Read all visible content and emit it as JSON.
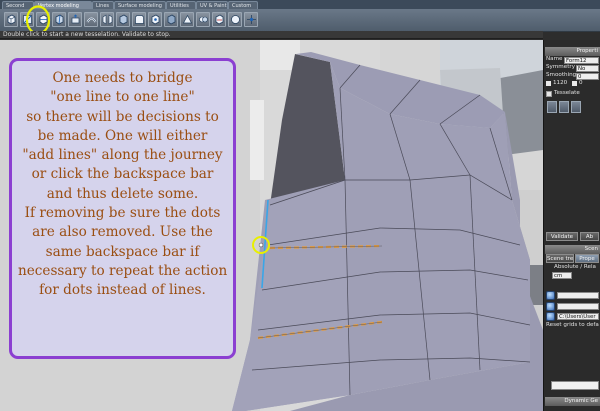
{
  "tabs": [
    {
      "label": "Second",
      "active": false
    },
    {
      "label": "Vertex modeling",
      "active": true
    },
    {
      "label": "Lines",
      "active": false
    },
    {
      "label": "Surface modeling",
      "active": false
    },
    {
      "label": "Utilities",
      "active": false
    },
    {
      "label": "UV & Paint",
      "active": false
    },
    {
      "label": "Custom",
      "active": false
    }
  ],
  "toolbar": {
    "tools": [
      "tesselate-tool",
      "add-line-tool",
      "quick-tesselate-tool",
      "split-tool",
      "extrude-tool",
      "sweep-tool",
      "bridge-tool",
      "connect-tool",
      "bevel-tool",
      "chamfer-tool",
      "solidify-tool",
      "weld-tool",
      "merge-tool",
      "fill-tool",
      "smooth-tool",
      "move-tool"
    ],
    "highlight_color": "#e8f000"
  },
  "status": {
    "message": "Double click to start a new tesselation. Validate to stop."
  },
  "note": {
    "border_color": "#8b3fd1",
    "text_color": "#9a4e12",
    "lines": [
      "One needs to bridge",
      "\"one line to one line\"",
      "so there will be decisions to",
      "be made. One will either",
      "\"add lines\" along the journey",
      "or click the backspace bar",
      "and thus delete some.",
      "If removing be sure the dots",
      "are also removed. Use the",
      "same backspace bar if",
      "necessary to repeat the action",
      "for dots instead of lines."
    ]
  },
  "viewport": {
    "mesh_color": "#a0a0b8",
    "dash_color": "#e39a3c",
    "edge_color": "#39a6e8"
  },
  "properties": {
    "header": "Properti",
    "name_label": "Name",
    "name_value": "Form12",
    "symmetry_label": "Symmetry",
    "symmetry_value": "No",
    "smoothing_label": "Smoothing",
    "smoothing_value": "0",
    "count_1": "1120",
    "count_2": "0",
    "tesselate_label": "Tesselate",
    "validate_label": "Validate",
    "cancel_label": "Ab",
    "scene_header": "Scen",
    "scene_tree_tab": "Scene tree",
    "props_tab": "Prope",
    "absolute_relative": "Absolute / Rela",
    "unit_value": "cm",
    "path_value": "C:\\Users\\User",
    "reset_grids": "Reset grids to defa",
    "dynamic_header": "Dynamic Ge"
  }
}
